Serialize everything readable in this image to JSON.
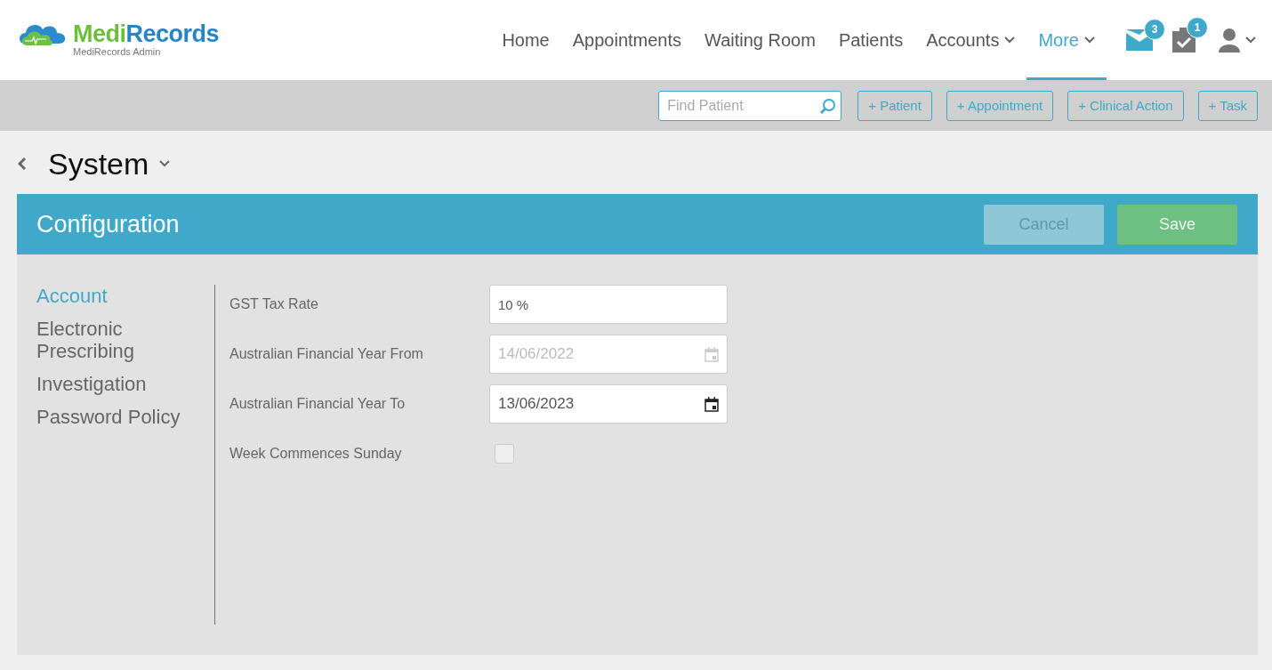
{
  "brand": {
    "prefix": "Medi",
    "suffix": "Records",
    "subtitle": "MediRecords Admin"
  },
  "nav": [
    {
      "label": "Home",
      "selected": false,
      "dropdown": false
    },
    {
      "label": "Appointments",
      "selected": false,
      "dropdown": false
    },
    {
      "label": "Waiting Room",
      "selected": false,
      "dropdown": false
    },
    {
      "label": "Patients",
      "selected": false,
      "dropdown": false
    },
    {
      "label": "Accounts",
      "selected": false,
      "dropdown": true
    },
    {
      "label": "More",
      "selected": true,
      "dropdown": true
    }
  ],
  "header_icons": [
    {
      "kind": "mail",
      "badge": "3"
    },
    {
      "kind": "tasks",
      "badge": "1"
    },
    {
      "kind": "user"
    }
  ],
  "toolbar": {
    "search": {
      "placeholder": "Find Patient"
    },
    "buttons": [
      "+ Patient",
      "+ Appointment",
      "+ Clinical Action",
      "+ Task"
    ]
  },
  "page_title": "System",
  "section": {
    "title": "Configuration",
    "buttons": [
      {
        "label": "Cancel",
        "kind": "cancel",
        "disabled": true
      },
      {
        "label": "Save",
        "kind": "save",
        "disabled": true
      }
    ]
  },
  "sidebar": {
    "items": [
      {
        "label": "Account",
        "selected": true
      },
      {
        "label": "Electronic Prescribing",
        "selected": false
      },
      {
        "label": "Investigation",
        "selected": false
      },
      {
        "label": "Password Policy",
        "selected": false
      }
    ]
  },
  "fields": [
    {
      "label": "GST Tax Rate",
      "kind": "text",
      "value": "10 %",
      "disabled": false
    },
    {
      "label": "Australian Financial Year From",
      "kind": "date",
      "value": "14/06/2022",
      "disabled": true
    },
    {
      "label": "Australian Financial Year To",
      "kind": "date",
      "value": "13/06/2023",
      "disabled": false
    },
    {
      "label": "Week Commences Sunday",
      "kind": "checkbox",
      "checked": false
    }
  ]
}
